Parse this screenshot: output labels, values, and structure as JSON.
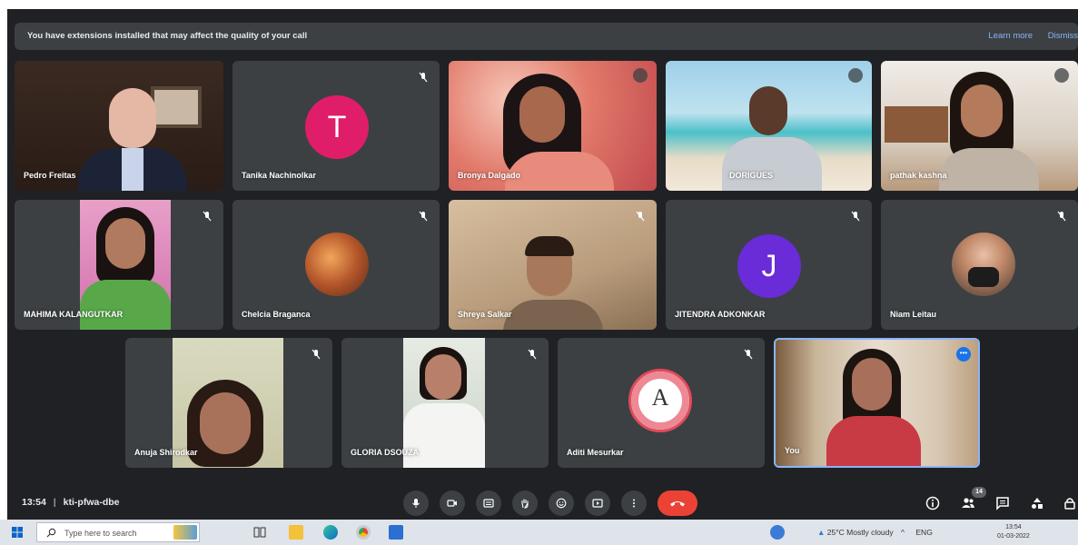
{
  "banner": {
    "message": "You have extensions installed that may affect the quality of your call",
    "learn_more": "Learn more",
    "dismiss": "Dismiss"
  },
  "participants": [
    {
      "name": "Pedro Freitas"
    },
    {
      "name": "Tanika Nachinolkar",
      "initial": "T",
      "avatar_color": "#e01d68"
    },
    {
      "name": "Bronya Dalgado"
    },
    {
      "name": "DORIGUES"
    },
    {
      "name": "pathak kashna"
    },
    {
      "name": "MAHIMA KALANGUTKAR"
    },
    {
      "name": "Chelcia Braganca"
    },
    {
      "name": "Shreya Salkar"
    },
    {
      "name": "JITENDRA ADKONKAR",
      "initial": "J",
      "avatar_color": "#6a2bd8"
    },
    {
      "name": "Niam Leitau"
    },
    {
      "name": "Anuja Shirodkar"
    },
    {
      "name": "GLORIA DSOUZA"
    },
    {
      "name": "Aditi Mesurkar",
      "initial": "A"
    },
    {
      "name": "You"
    }
  ],
  "controls": {
    "time": "13:54",
    "separator": "|",
    "meeting_code": "kti-pfwa-dbe",
    "people_count": "14",
    "end_call_color": "#ea4335"
  },
  "taskbar": {
    "search_placeholder": "Type here to search",
    "weather": "25°C  Mostly cloudy",
    "language": "ENG",
    "clock_time": "13:54",
    "clock_date": "01-03-2022"
  },
  "icons": [
    "windows-icon",
    "search-icon",
    "task-view-icon",
    "file-explorer-icon",
    "edge-icon",
    "chrome-icon",
    "mic-icon",
    "camera-icon",
    "captions-icon",
    "raise-hand-icon",
    "emoji-icon",
    "present-icon",
    "more-options-icon",
    "end-call-icon",
    "info-icon",
    "people-icon",
    "chat-icon",
    "activities-icon",
    "lock-icon"
  ]
}
